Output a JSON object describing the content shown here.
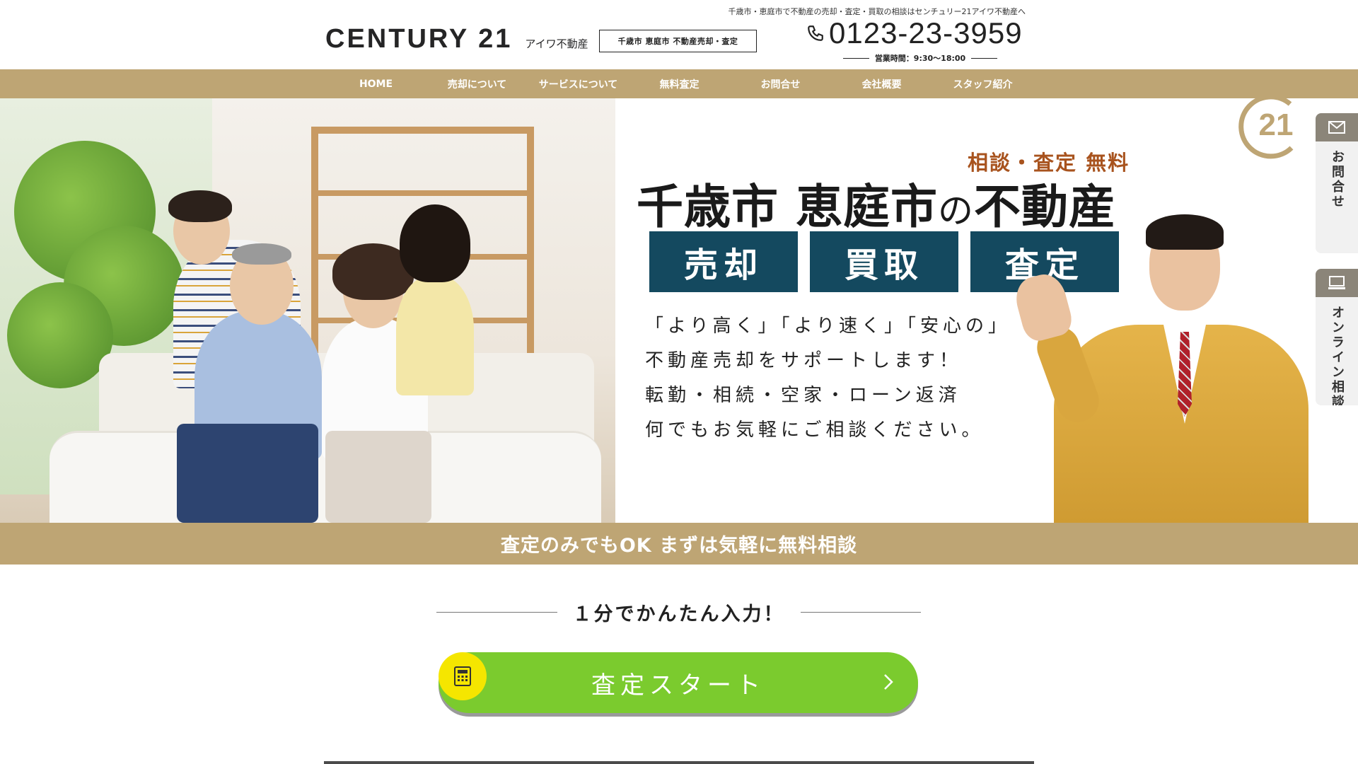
{
  "header": {
    "tagline": "千歳市・恵庭市で不動産の売却・査定・買取の相談はセンチュリー21アイワ不動産へ",
    "logo_main": "CENTURY 21",
    "logo_sub": "アイワ不動産",
    "area_badge": "千歳市 恵庭市 不動産売却・査定",
    "phone": "0123-23-3959",
    "hours": "営業時間：9:30〜18:00"
  },
  "nav": {
    "items": [
      {
        "label": "HOME"
      },
      {
        "label": "売却について"
      },
      {
        "label": "サービスについて"
      },
      {
        "label": "無料査定"
      },
      {
        "label": "お問合せ"
      },
      {
        "label": "会社概要"
      },
      {
        "label": "スタッフ紹介"
      }
    ]
  },
  "hero": {
    "sub": "相談・査定 無料",
    "title_main": "千歳市 恵庭市",
    "title_no": "の",
    "title_tail": "不動産",
    "boxes": [
      "売却",
      "買取",
      "査定"
    ],
    "copy": [
      "「より高く」「より速く」「安心の」",
      "不動産売却をサポートします！",
      "転勤・相続・空家・ローン返済",
      "何でもお気軽にご相談ください。"
    ],
    "mark_text": "21"
  },
  "side": {
    "contact": "お問合せ",
    "online": "オンライン相談"
  },
  "banner": {
    "text": "査定のみでもOK まずは気軽に無料相談"
  },
  "cta": {
    "quick": "１分でかんたん入力！",
    "start": "査定スタート"
  },
  "colors": {
    "gold": "#bea574",
    "navy": "#14495f",
    "green": "#7bcb2e",
    "accent_red": "#a8531e"
  },
  "icons": [
    "phone-icon",
    "mail-icon",
    "monitor-icon",
    "calculator-icon",
    "chevron-right-icon"
  ]
}
